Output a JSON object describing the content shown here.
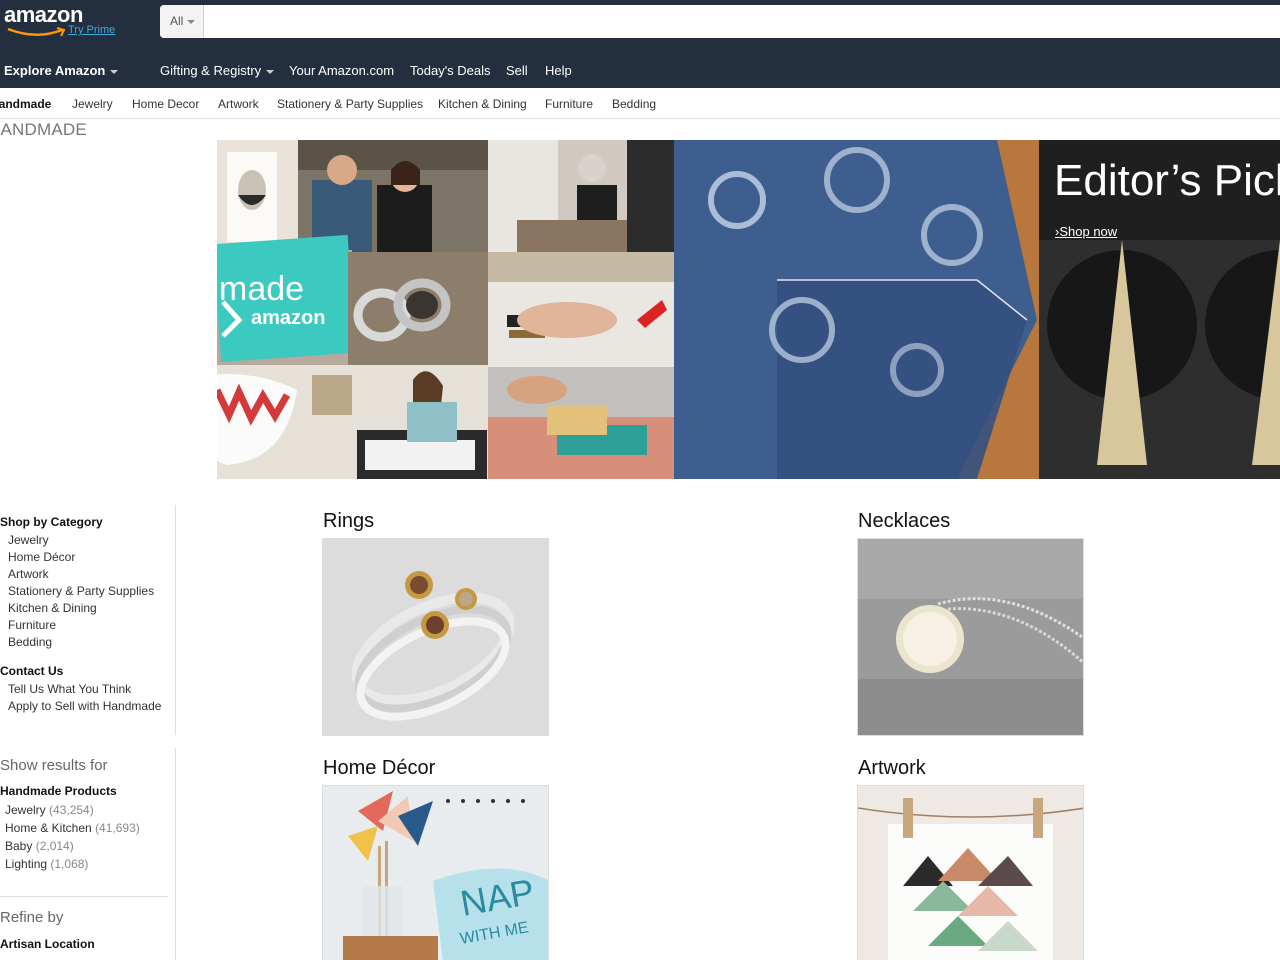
{
  "header": {
    "logo_text": "amazon",
    "logo_prime": "Try Prime",
    "search_category": "All",
    "search_placeholder": "",
    "explore": "Explore Amazon",
    "nav": [
      "Gifting & Registry",
      "Your Amazon.com",
      "Today's Deals",
      "Sell",
      "Help"
    ]
  },
  "subnav": [
    "Handmade",
    "Jewelry",
    "Home Decor",
    "Artwork",
    "Stationery & Party Supplies",
    "Kitchen & Dining",
    "Furniture",
    "Bedding"
  ],
  "page_title": "HANDMADE",
  "hero": {
    "badge_line1": "made",
    "badge_line2": "amazon",
    "editor_title": "Editor’s Pick",
    "shop_now": "Shop now"
  },
  "sidebar": {
    "shop_by_category": "Shop by Category",
    "categories": [
      "Jewelry",
      "Home Décor",
      "Artwork",
      "Stationery & Party Supplies",
      "Kitchen & Dining",
      "Furniture",
      "Bedding"
    ],
    "contact_us": "Contact Us",
    "contact_links": [
      "Tell Us What You Think",
      "Apply to Sell with Handmade"
    ],
    "show_results_for": "Show results for",
    "handmade_products": "Handmade Products",
    "results": [
      {
        "label": "Jewelry",
        "count": "(43,254)"
      },
      {
        "label": "Home & Kitchen",
        "count": "(41,693)"
      },
      {
        "label": "Baby",
        "count": "(2,014)"
      },
      {
        "label": "Lighting",
        "count": "(1,068)"
      }
    ],
    "refine_by": "Refine by",
    "artisan_location": "Artisan Location"
  },
  "categories_grid": [
    {
      "label": "Rings"
    },
    {
      "label": "Necklaces"
    },
    {
      "label": "Home Décor",
      "pillow_text_1": "NAP",
      "pillow_text_2": "WITH ME"
    },
    {
      "label": "Artwork"
    }
  ],
  "colors": {
    "header_bg": "#232f3e",
    "prime_link": "#3fa9e0",
    "badge_teal": "#3cc9c0"
  }
}
